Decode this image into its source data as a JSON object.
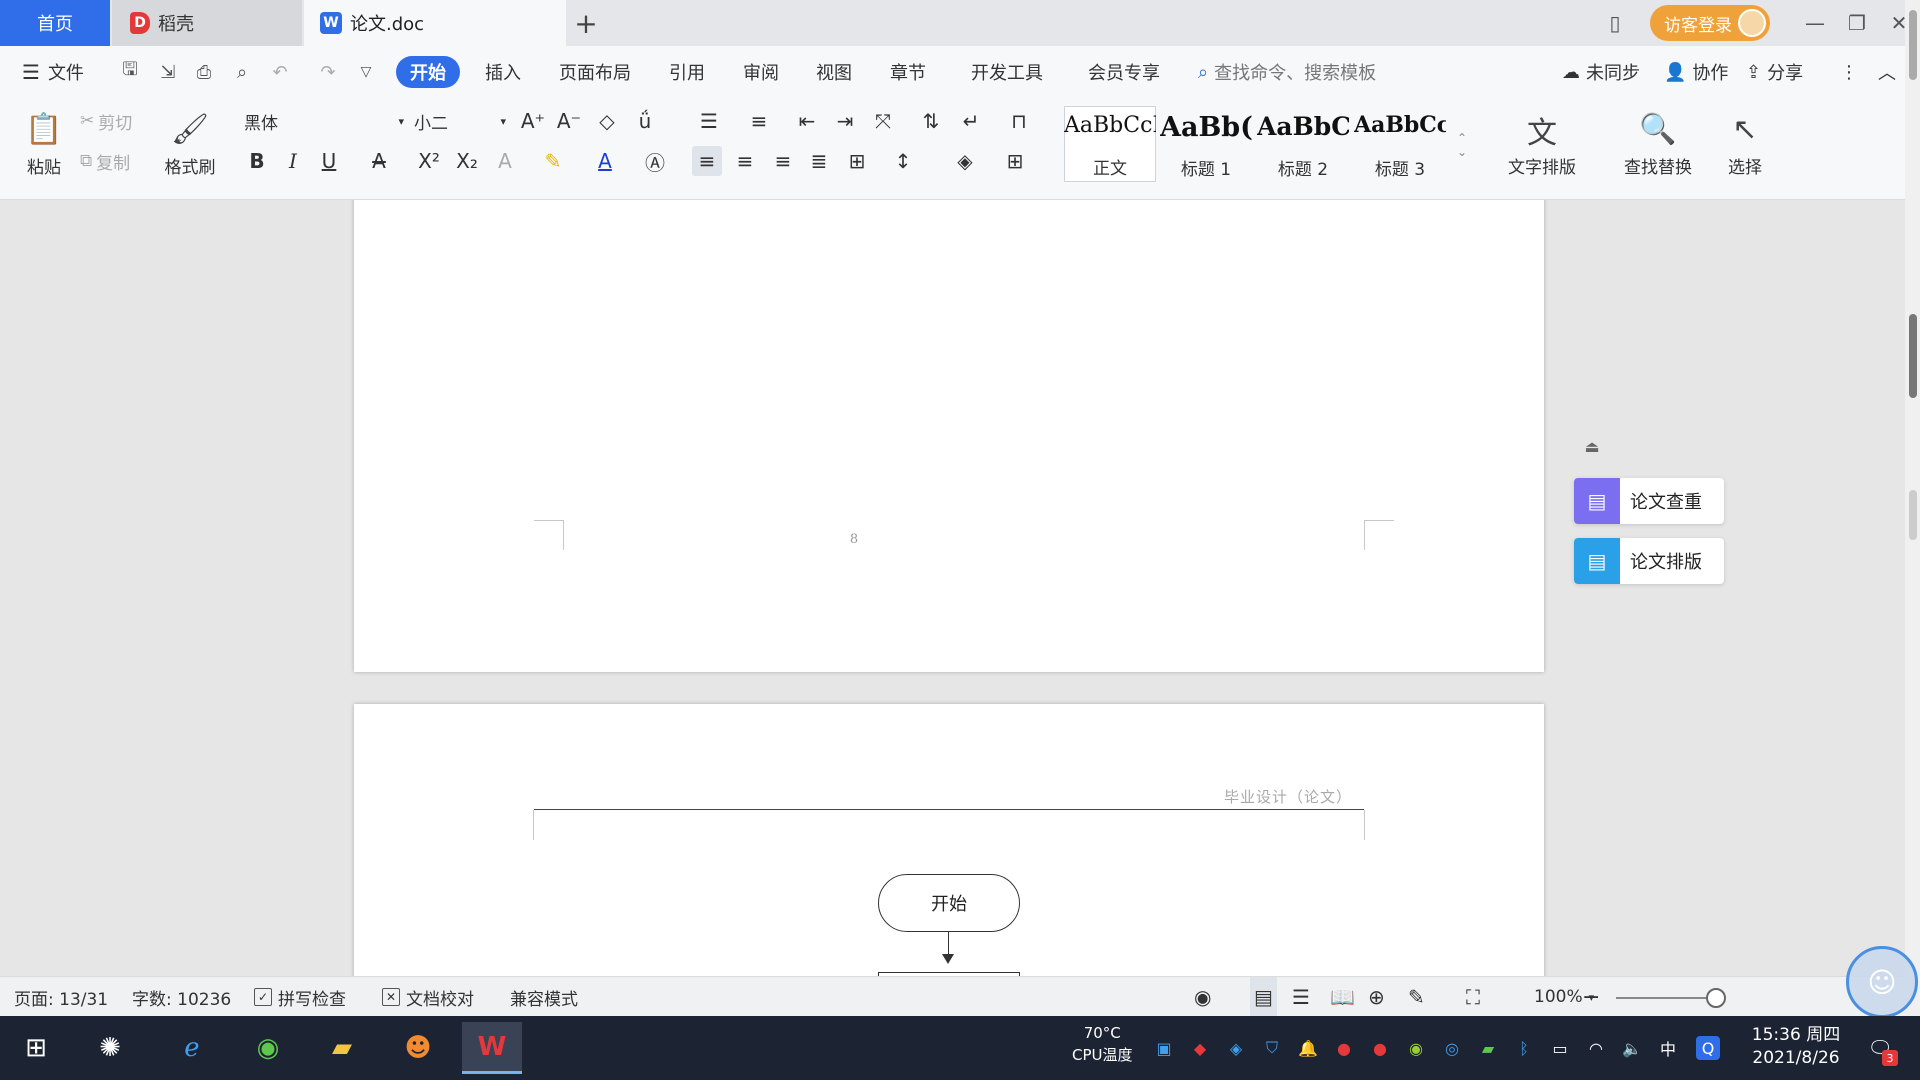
{
  "tabs": {
    "home": "首页",
    "daoke": "稻壳",
    "doc": "论文.doc",
    "plus": "+",
    "login": "访客登录"
  },
  "menu": {
    "file": "文件",
    "items": [
      "开始",
      "插入",
      "页面布局",
      "引用",
      "审阅",
      "视图",
      "章节",
      "开发工具",
      "会员专享"
    ],
    "search_cmd": "查找命令、搜索模板",
    "sync": "未同步",
    "collab": "协作",
    "share": "分享"
  },
  "ribbon": {
    "paste": "粘贴",
    "cut": "剪切",
    "copy": "复制",
    "format_painter": "格式刷",
    "font_name": "黑体",
    "font_size": "小二",
    "styles": [
      {
        "sample": "AaBbCcI",
        "label": "正文"
      },
      {
        "sample": "AaBb(",
        "label": "标题 1"
      },
      {
        "sample": "AaBbC",
        "label": "标题 2"
      },
      {
        "sample": "AaBbCcl",
        "label": "标题 3"
      }
    ],
    "text_layout": "文字排版",
    "find_replace": "查找替换",
    "select": "选择"
  },
  "document": {
    "page_number": "8",
    "header_text": "毕业设计（论文）",
    "flow_start": "开始"
  },
  "side_panel": {
    "check": "论文查重",
    "format": "论文排版"
  },
  "status": {
    "page": "页面: 13/31",
    "words": "字数: 10236",
    "spell": "拼写检查",
    "proof": "文档校对",
    "compat": "兼容模式",
    "zoom": "100%"
  },
  "taskbar": {
    "cpu_temp": "70°C",
    "cpu_label": "CPU温度",
    "ime": "中",
    "time": "15:36 周四",
    "date": "2021/8/26",
    "notif_count": "3"
  },
  "colors": {
    "accent": "#2f6ee8",
    "login": "#f0a23a",
    "side_check": "#7b6ef0",
    "side_format": "#2aa0e8"
  }
}
